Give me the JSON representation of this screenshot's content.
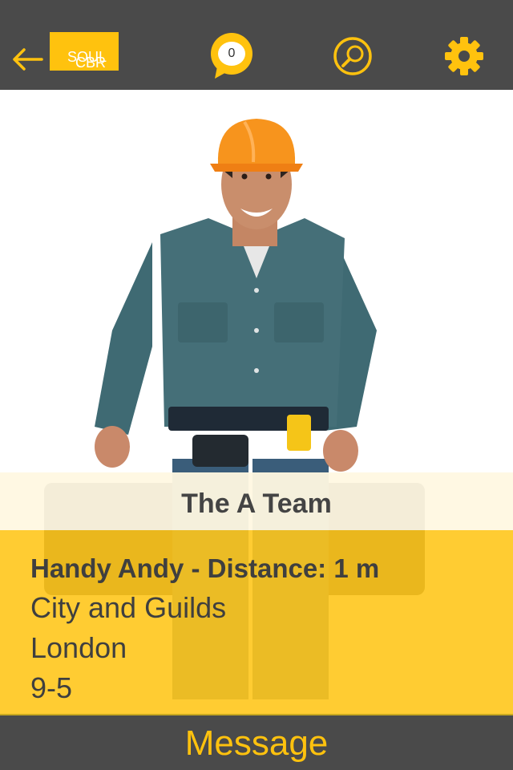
{
  "header": {
    "logo": {
      "line1": "SOUL",
      "line2": "CBR"
    },
    "chat_count": "0"
  },
  "profile": {
    "team_name": "The A Team",
    "name_distance": "Handy Andy - Distance: 1 m",
    "qualification": "City and Guilds",
    "location": "London",
    "hours": "9-5"
  },
  "footer": {
    "message_label": "Message"
  },
  "colors": {
    "accent": "#ffc20e",
    "bar": "#4a4a4a",
    "panel": "#ffc61c"
  },
  "icons": [
    "back-arrow-icon",
    "chat-bubble-icon",
    "search-icon",
    "gear-icon"
  ]
}
